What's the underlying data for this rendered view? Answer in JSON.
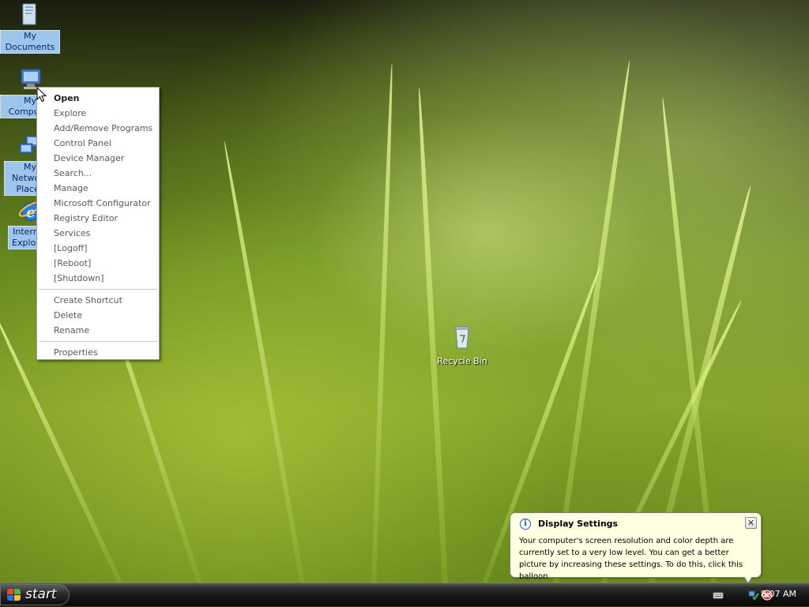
{
  "desktop": {
    "icons": [
      {
        "name": "my-documents-icon",
        "label": "My Documents",
        "selected": true
      },
      {
        "name": "my-computer-icon",
        "label": "My Computer",
        "selected": true
      },
      {
        "name": "my-network-places-icon",
        "label": "My Network Places",
        "selected": true
      },
      {
        "name": "internet-explorer-icon",
        "label": "Internet Explorer",
        "selected": true
      },
      {
        "name": "recycle-bin-icon",
        "label": "Recycle Bin",
        "selected": false
      }
    ]
  },
  "context_menu": {
    "items": [
      {
        "label": "Open",
        "bold": true
      },
      {
        "label": "Explore"
      },
      {
        "label": "Add/Remove Programs"
      },
      {
        "label": "Control Panel"
      },
      {
        "label": "Device Manager"
      },
      {
        "label": "Search..."
      },
      {
        "label": "Manage"
      },
      {
        "label": "Microsoft Configurator"
      },
      {
        "label": "Registry Editor"
      },
      {
        "label": "Services"
      },
      {
        "label": "[Logoff]"
      },
      {
        "label": "[Reboot]"
      },
      {
        "label": "[Shutdown]"
      },
      {
        "separator": true
      },
      {
        "label": "Create Shortcut"
      },
      {
        "label": "Delete"
      },
      {
        "label": "Rename"
      },
      {
        "separator": true
      },
      {
        "label": "Properties"
      }
    ]
  },
  "taskbar": {
    "start_label": "start",
    "clock": "8:07 AM"
  },
  "balloon": {
    "title": "Display Settings",
    "body": "Your computer's screen resolution and color depth are currently set to a very low level. You can get a better picture by increasing these settings. To do this, click this balloon",
    "close_glyph": "✕",
    "info_glyph": "i"
  },
  "colors": {
    "selection": "#9dc6ea",
    "balloon_bg": "#ffffe1",
    "taskbar": "#141414"
  }
}
